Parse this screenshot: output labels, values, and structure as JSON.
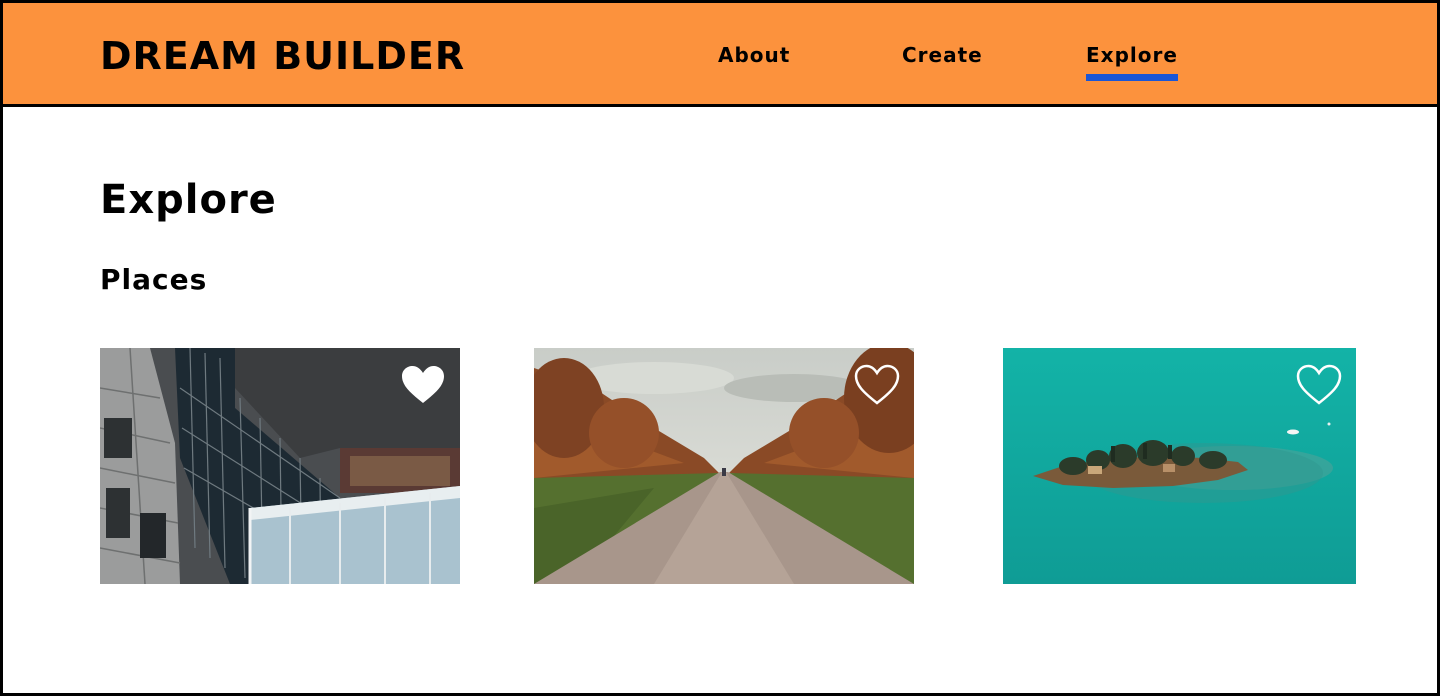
{
  "header": {
    "brand": "DREAM BUILDER",
    "background_color": "#FC923D",
    "nav": [
      {
        "label": "About",
        "active": false
      },
      {
        "label": "Create",
        "active": false
      },
      {
        "label": "Explore",
        "active": true
      }
    ],
    "active_indicator_color": "#1A56D6"
  },
  "main": {
    "title": "Explore",
    "section_title": "Places",
    "places": [
      {
        "image": "modern-building-photo",
        "favorited": true,
        "icon": "heart-filled-icon"
      },
      {
        "image": "tree-lined-avenue-photo",
        "favorited": false,
        "icon": "heart-outline-icon"
      },
      {
        "image": "island-in-turquoise-lake-photo",
        "favorited": false,
        "icon": "heart-outline-icon"
      }
    ]
  }
}
